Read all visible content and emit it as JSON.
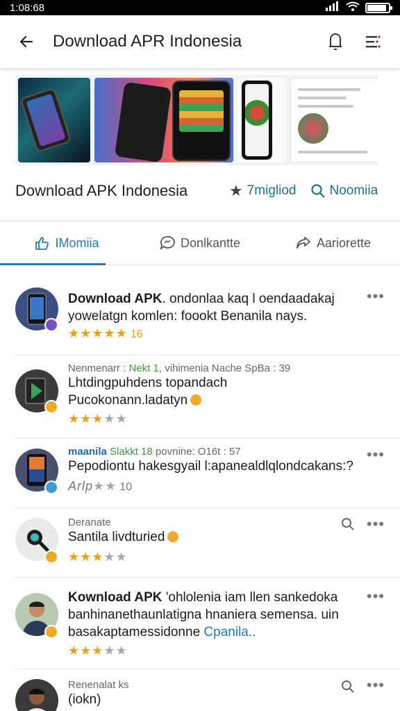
{
  "status": {
    "time": "1:08:68",
    "battery_level": 0.9
  },
  "appbar": {
    "title": "Download APR Indonesia"
  },
  "app": {
    "title": "Download APK Indonesia",
    "rating_text": "7migliod",
    "search_text": "Noomiia"
  },
  "tabs": [
    {
      "label": "IMomiia",
      "icon": "thumb-icon",
      "active": true
    },
    {
      "label": "Donlkantte",
      "icon": "chat-icon",
      "active": false
    },
    {
      "label": "Aariorette",
      "icon": "share-icon",
      "active": false
    }
  ],
  "reviews": [
    {
      "title": "Download APK",
      "line1": ". ondonlaa kaq l oendaadakaj",
      "line2": "yowelatgn komlen: foookt Benanila nays.",
      "stars_filled": 5,
      "stars_text": "16",
      "avatar_bg": "#3b4f82",
      "badge_color": "#7b4fc9"
    },
    {
      "meta_author": "Nenmenarr :",
      "meta_green": "Nekt 1",
      "meta_rest": ", vihimenia Nache SpBa : 39",
      "line1": "Lhtdingpuhdens topandach",
      "line2": "Pucokonann.ladatyn",
      "stars_filled": 3,
      "avatar_bg": "#3b3b3b",
      "badge_color": "#efaa2a"
    },
    {
      "meta_blue": "maanila",
      "meta_green": "Slakkt 18",
      "meta_rest": "povnine: O16t : 57",
      "line1": "Pepodiontu hakesgyail l:apanealdlqlondcakans:?",
      "stars_label": "Arlp",
      "stars_filled": 0,
      "stars_text": "10",
      "avatar_bg": "#4a4f6e",
      "badge_color": "#3f9ad6"
    },
    {
      "meta_author": "Deranate",
      "line1": "Santila livdturied",
      "stars_filled": 3,
      "avatar_bg": "#e9e9e9",
      "badge_color": "#efaa2a"
    },
    {
      "title": "Kownload APK",
      "line1": "'ohlolenia iam llen sankedoka",
      "line2": "banhinanethaunlatigna hnaniera semensa.  uin",
      "line3": "basakaptamessidonne",
      "link": "Cpanila..",
      "stars_filled": 3,
      "avatar_bg": "#b8c9b0",
      "badge_color": "#efaa2a"
    },
    {
      "meta_author": "Renenalat ks",
      "line1": "(iokn)",
      "avatar_bg": "#3a3a3a",
      "badge_color": "#efaa2a"
    }
  ]
}
